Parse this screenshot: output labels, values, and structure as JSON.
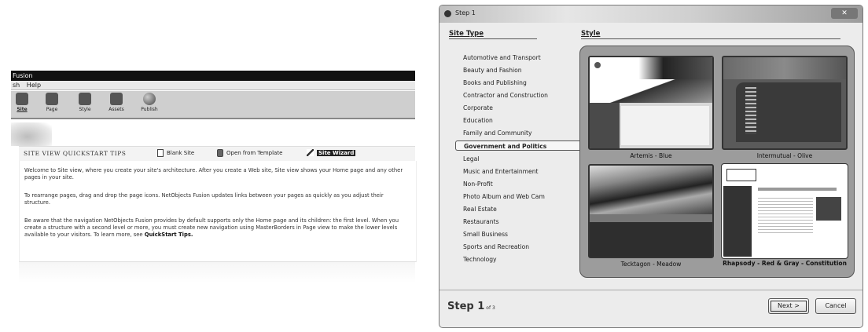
{
  "nof": {
    "title": "Fusion",
    "menu": [
      "sh",
      "Help"
    ],
    "toolbar": [
      {
        "label": "Site",
        "icon": "site-icon"
      },
      {
        "label": "Page",
        "icon": "page-icon"
      },
      {
        "label": "Style",
        "icon": "style-icon"
      },
      {
        "label": "Assets",
        "icon": "assets-icon"
      },
      {
        "label": "Publish",
        "icon": "publish-icon"
      }
    ],
    "tips_heading": "SITE VIEW QUICKSTART TIPS",
    "links": {
      "blank_site": "Blank Site",
      "open_template": "Open from Template",
      "site_wizard": "Site Wizard"
    },
    "paragraphs": [
      "Welcome to Site view, where you create your site's architecture. After you create a Web site, Site view shows your Home page and any other pages in your site.",
      "To rearrange pages, drag and drop the page icons. NetObjects Fusion updates links between your pages as quickly as you adjust their structure.",
      "Be aware that the navigation NetObjects Fusion provides by default supports only the Home page and its children: the first level. When you create a structure with a second level or more, you must create new navigation using MasterBorders in Page view to make the lower levels available to your visitors. To learn more, see"
    ],
    "quickstart_link": "QuickStart Tips."
  },
  "dialog": {
    "title": "Step 1",
    "close": "✕",
    "site_type_header": "Site Type",
    "style_header": "Style",
    "site_types": [
      "Automotive and Transport",
      "Beauty and Fashion",
      "Books and Publishing",
      "Contractor and Construction",
      "Corporate",
      "Education",
      "Family and Community",
      "Government and Politics",
      "Legal",
      "Music and Entertainment",
      "Non-Profit",
      "Photo Album and Web Cam",
      "Real Estate",
      "Restaurants",
      "Small Business",
      "Sports and Recreation",
      "Technology"
    ],
    "selected_site_type": "Government and Politics",
    "styles": [
      "Artemis - Blue",
      "Intermutual - Olive",
      "Tecktagon - Meadow",
      "Rhapsody - Red & Gray - Constitution"
    ],
    "selected_style": "Rhapsody - Red & Gray - Constitution",
    "step_label": "Step 1",
    "step_of": "of 3",
    "next_label": "Next >",
    "cancel_label": "Cancel"
  }
}
